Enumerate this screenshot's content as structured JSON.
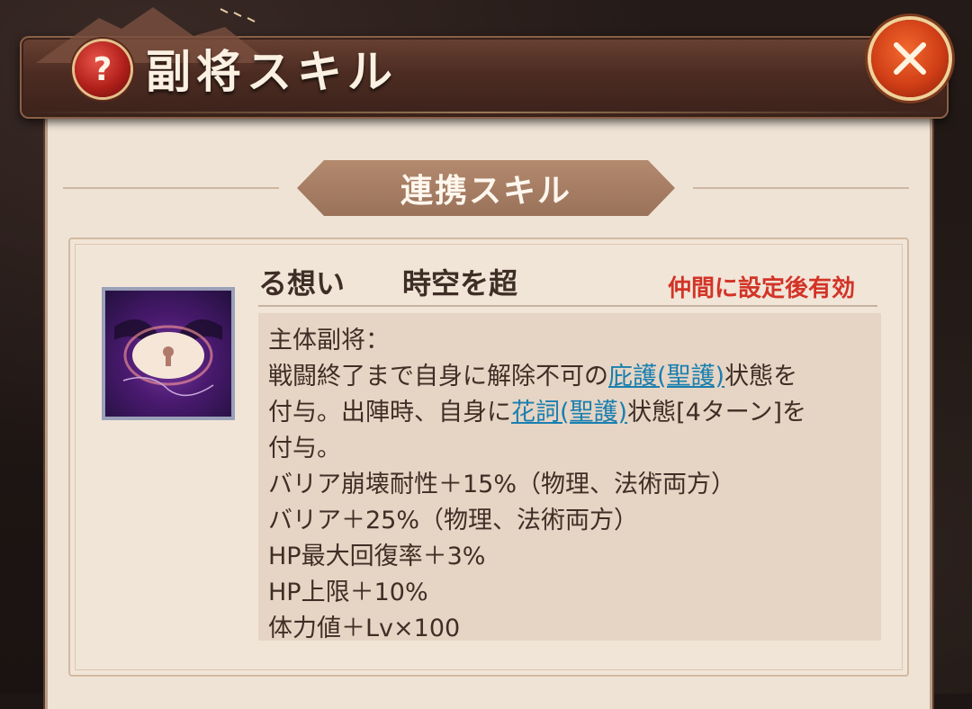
{
  "header": {
    "title": "副将スキル",
    "help_icon_glyph": "?"
  },
  "section": {
    "tab_label": "連携スキル"
  },
  "skill": {
    "name": "る想い　　時空を超",
    "status": "仲間に設定後有効",
    "lines": [
      {
        "text": "主体副将："
      },
      {
        "pre": "戦闘終了まで自身に解除不可の",
        "link": "庇護(聖護)",
        "post": "状態を"
      },
      {
        "pre": "付与。出陣時、自身に",
        "link": "花詞(聖護)",
        "post": "状態[4ターン]を"
      },
      {
        "text": "付与。"
      },
      {
        "text": "バリア崩壊耐性＋15%（物理、法術両方）"
      },
      {
        "text": "バリア＋25%（物理、法術両方）"
      },
      {
        "text": "HP最大回復率＋3%"
      },
      {
        "text": "HP上限＋10%"
      },
      {
        "text": "体力値＋Lv×100"
      }
    ]
  },
  "colors": {
    "link": "#1a7fb0",
    "status": "#d23427",
    "panel": "#efe3d6"
  }
}
